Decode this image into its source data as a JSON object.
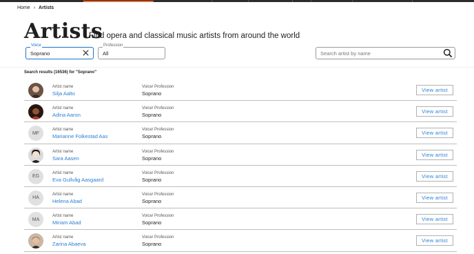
{
  "breadcrumb": {
    "home": "Home",
    "separator": "›",
    "current": "Artists"
  },
  "page": {
    "title": "Artists",
    "subtitle": "Find opera and classical music artists from around the world"
  },
  "filters": {
    "voice": {
      "legend": "Voice",
      "value": "Soprano",
      "clear_icon": "close-icon"
    },
    "profession": {
      "legend": "Profession",
      "value": "All"
    },
    "search": {
      "placeholder": "Search artist by name",
      "icon": "search-icon"
    }
  },
  "results": {
    "summary": "Search results (16536) for \"Soprano\"",
    "name_label": "Artist name",
    "voice_label": "Voice/ Profession",
    "button_label": "View artist",
    "rows": [
      {
        "name": "Silja Aalto",
        "voice": "Soprano",
        "avatar": "photo",
        "initials": ""
      },
      {
        "name": "Adina Aaron",
        "voice": "Soprano",
        "avatar": "photo",
        "initials": ""
      },
      {
        "name": "Marianne Folkestad Aas",
        "voice": "Soprano",
        "avatar": "initials",
        "initials": "MF"
      },
      {
        "name": "Sara Aasen",
        "voice": "Soprano",
        "avatar": "photo",
        "initials": ""
      },
      {
        "name": "Eva Gullvåg Aasgaard",
        "voice": "Soprano",
        "avatar": "initials",
        "initials": "EG"
      },
      {
        "name": "Helena Abad",
        "voice": "Soprano",
        "avatar": "initials",
        "initials": "HA"
      },
      {
        "name": "Miriam Abad",
        "voice": "Soprano",
        "avatar": "initials",
        "initials": "MA"
      },
      {
        "name": "Zarina Abaeva",
        "voice": "Soprano",
        "avatar": "photo",
        "initials": ""
      }
    ]
  },
  "colors": {
    "accent": "#e9692c",
    "link": "#2a7fd4",
    "focus": "#1a73c8"
  }
}
